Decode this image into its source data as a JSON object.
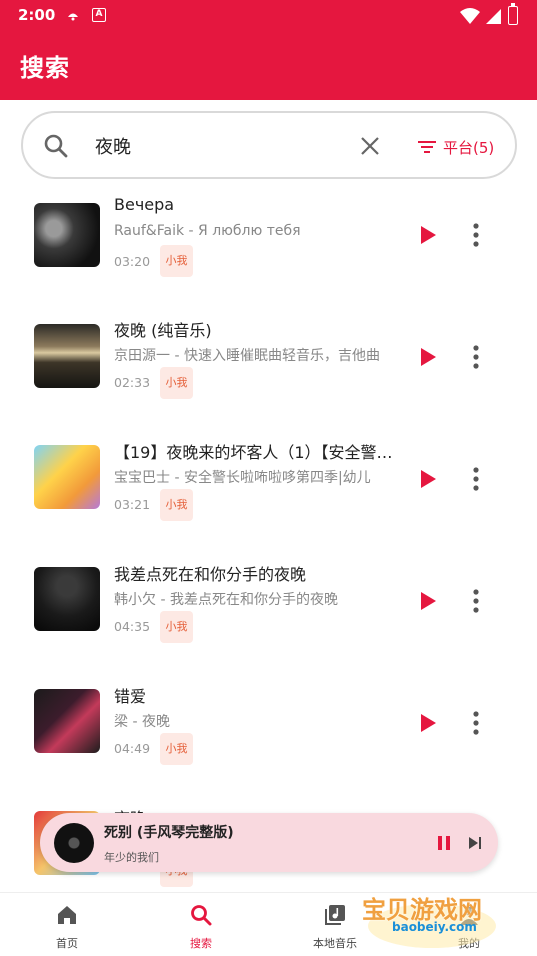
{
  "status_bar": {
    "time": "2:00",
    "notif_badge": "A"
  },
  "app_bar": {
    "title": "搜索"
  },
  "search": {
    "value": "夜晚",
    "platform_label": "平台(5)"
  },
  "results": [
    {
      "title": "Вечера",
      "subtitle": "Rauf&Faik - Я люблю тебя",
      "duration": "03:20",
      "tag": "小我"
    },
    {
      "title": "夜晚 (纯音乐)",
      "subtitle": "京田源一 - 快速入睡催眠曲轻音乐，吉他曲",
      "duration": "02:33",
      "tag": "小我"
    },
    {
      "title": "【19】夜晚来的坏客人（1）【安全警长】",
      "subtitle": "宝宝巴士 - 安全警长啦咘啦哆第四季|幼儿",
      "duration": "03:21",
      "tag": "小我"
    },
    {
      "title": "我差点死在和你分手的夜晚",
      "subtitle": "韩小欠 - 我差点死在和你分手的夜晚",
      "duration": "04:35",
      "tag": "小我"
    },
    {
      "title": "错爱",
      "subtitle": "梁 - 夜晚",
      "duration": "04:49",
      "tag": "小我"
    },
    {
      "title": "夜晚",
      "subtitle": "",
      "duration": "",
      "tag": "小我"
    }
  ],
  "mini_player": {
    "title": "死别 (手风琴完整版)",
    "subtitle": "年少的我们"
  },
  "bottom_nav": [
    {
      "label": "首页",
      "icon": "home-icon"
    },
    {
      "label": "搜索",
      "icon": "search-icon",
      "active": true
    },
    {
      "label": "本地音乐",
      "icon": "local-music-icon"
    },
    {
      "label": "我的",
      "icon": "profile-icon"
    }
  ],
  "watermark": {
    "text": "宝贝游戏网",
    "url": "baobeiy.com"
  },
  "colors": {
    "accent": "#e5173f",
    "tag_bg": "#fde9e4",
    "tag_text": "#e5603a",
    "mini_bg": "#f9d9df"
  }
}
